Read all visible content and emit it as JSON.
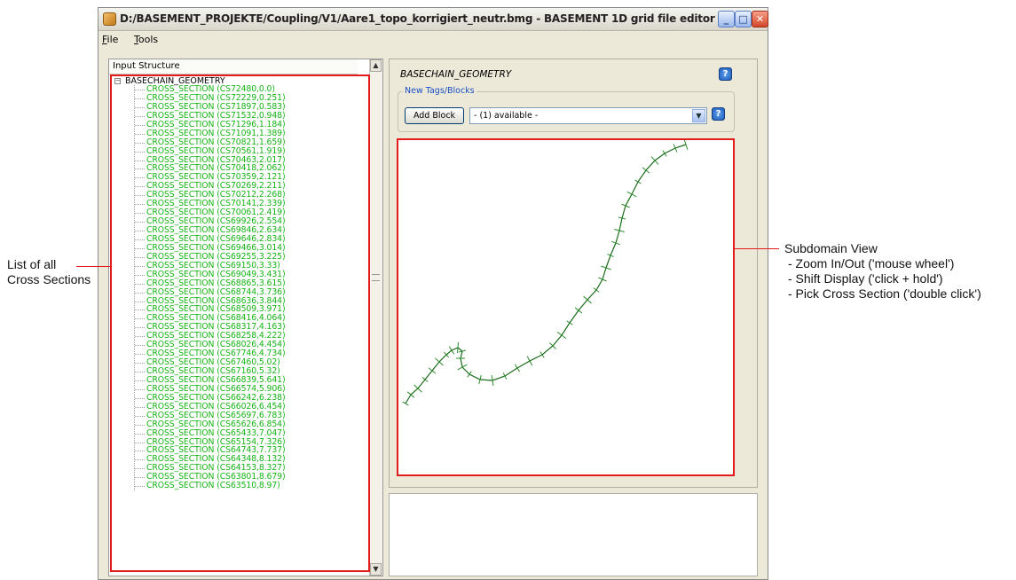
{
  "window": {
    "title": "D:/BASEMENT_PROJEKTE/Coupling/V1/Aare1_topo_korrigiert_neutr.bmg - BASEMENT 1D grid file editor",
    "minimize": "_",
    "maximize": "□",
    "close": "✕"
  },
  "menu": {
    "file": {
      "hot": "F",
      "rest": "ile"
    },
    "tools": {
      "hot": "T",
      "rest": "ools"
    }
  },
  "tree": {
    "header": "Input Structure",
    "root": "BASECHAIN_GEOMETRY",
    "items": [
      "CROSS_SECTION (CS72480,0.0)",
      "CROSS_SECTION (CS72229,0.251)",
      "CROSS_SECTION (CS71897,0.583)",
      "CROSS_SECTION (CS71532,0.948)",
      "CROSS_SECTION (CS71296,1.184)",
      "CROSS_SECTION (CS71091,1.389)",
      "CROSS_SECTION (CS70821,1.659)",
      "CROSS_SECTION (CS70561,1.919)",
      "CROSS_SECTION (CS70463,2.017)",
      "CROSS_SECTION (CS70418,2.062)",
      "CROSS_SECTION (CS70359,2.121)",
      "CROSS_SECTION (CS70269,2.211)",
      "CROSS_SECTION (CS70212,2.268)",
      "CROSS_SECTION (CS70141,2.339)",
      "CROSS_SECTION (CS70061,2.419)",
      "CROSS_SECTION (CS69926,2.554)",
      "CROSS_SECTION (CS69846,2.634)",
      "CROSS_SECTION (CS69646,2.834)",
      "CROSS_SECTION (CS69466,3.014)",
      "CROSS_SECTION (CS69255,3.225)",
      "CROSS_SECTION (CS69150,3.33)",
      "CROSS_SECTION (CS69049,3.431)",
      "CROSS_SECTION (CS68865,3.615)",
      "CROSS_SECTION (CS68744,3.736)",
      "CROSS_SECTION (CS68636,3.844)",
      "CROSS_SECTION (CS68509,3.971)",
      "CROSS_SECTION (CS68416,4.064)",
      "CROSS_SECTION (CS68317,4.163)",
      "CROSS_SECTION (CS68258,4.222)",
      "CROSS_SECTION (CS68026,4.454)",
      "CROSS_SECTION (CS67746,4.734)",
      "CROSS_SECTION (CS67460,5.02)",
      "CROSS_SECTION (CS67160,5.32)",
      "CROSS_SECTION (CS66839,5.641)",
      "CROSS_SECTION (CS66574,5.906)",
      "CROSS_SECTION (CS66242,6.238)",
      "CROSS_SECTION (CS66026,6.454)",
      "CROSS_SECTION (CS65697,6.783)",
      "CROSS_SECTION (CS65626,6.854)",
      "CROSS_SECTION (CS65433,7.047)",
      "CROSS_SECTION (CS65154,7.326)",
      "CROSS_SECTION (CS64743,7.737)",
      "CROSS_SECTION (CS64348,8.132)",
      "CROSS_SECTION (CS64153,8.327)",
      "CROSS_SECTION (CS63801,8.679)",
      "CROSS_SECTION (CS63510,8.97)"
    ]
  },
  "editor": {
    "block_title": "BASECHAIN_GEOMETRY",
    "group_label": "New Tags/Blocks",
    "add_block_label": "Add Block",
    "available_select": "- (1) available -",
    "help": "?"
  },
  "annotations": {
    "left": [
      "List of all",
      "Cross Sections"
    ],
    "right": [
      "Subdomain View",
      "- Zoom In/Out ('mouse wheel')",
      "- Shift Display ('click + hold')",
      "- Pick Cross Section ('double click')"
    ]
  },
  "colors": {
    "highlight_red": "#e21b1b",
    "tree_green": "#15b315",
    "river_line": "#1a6b1a"
  }
}
